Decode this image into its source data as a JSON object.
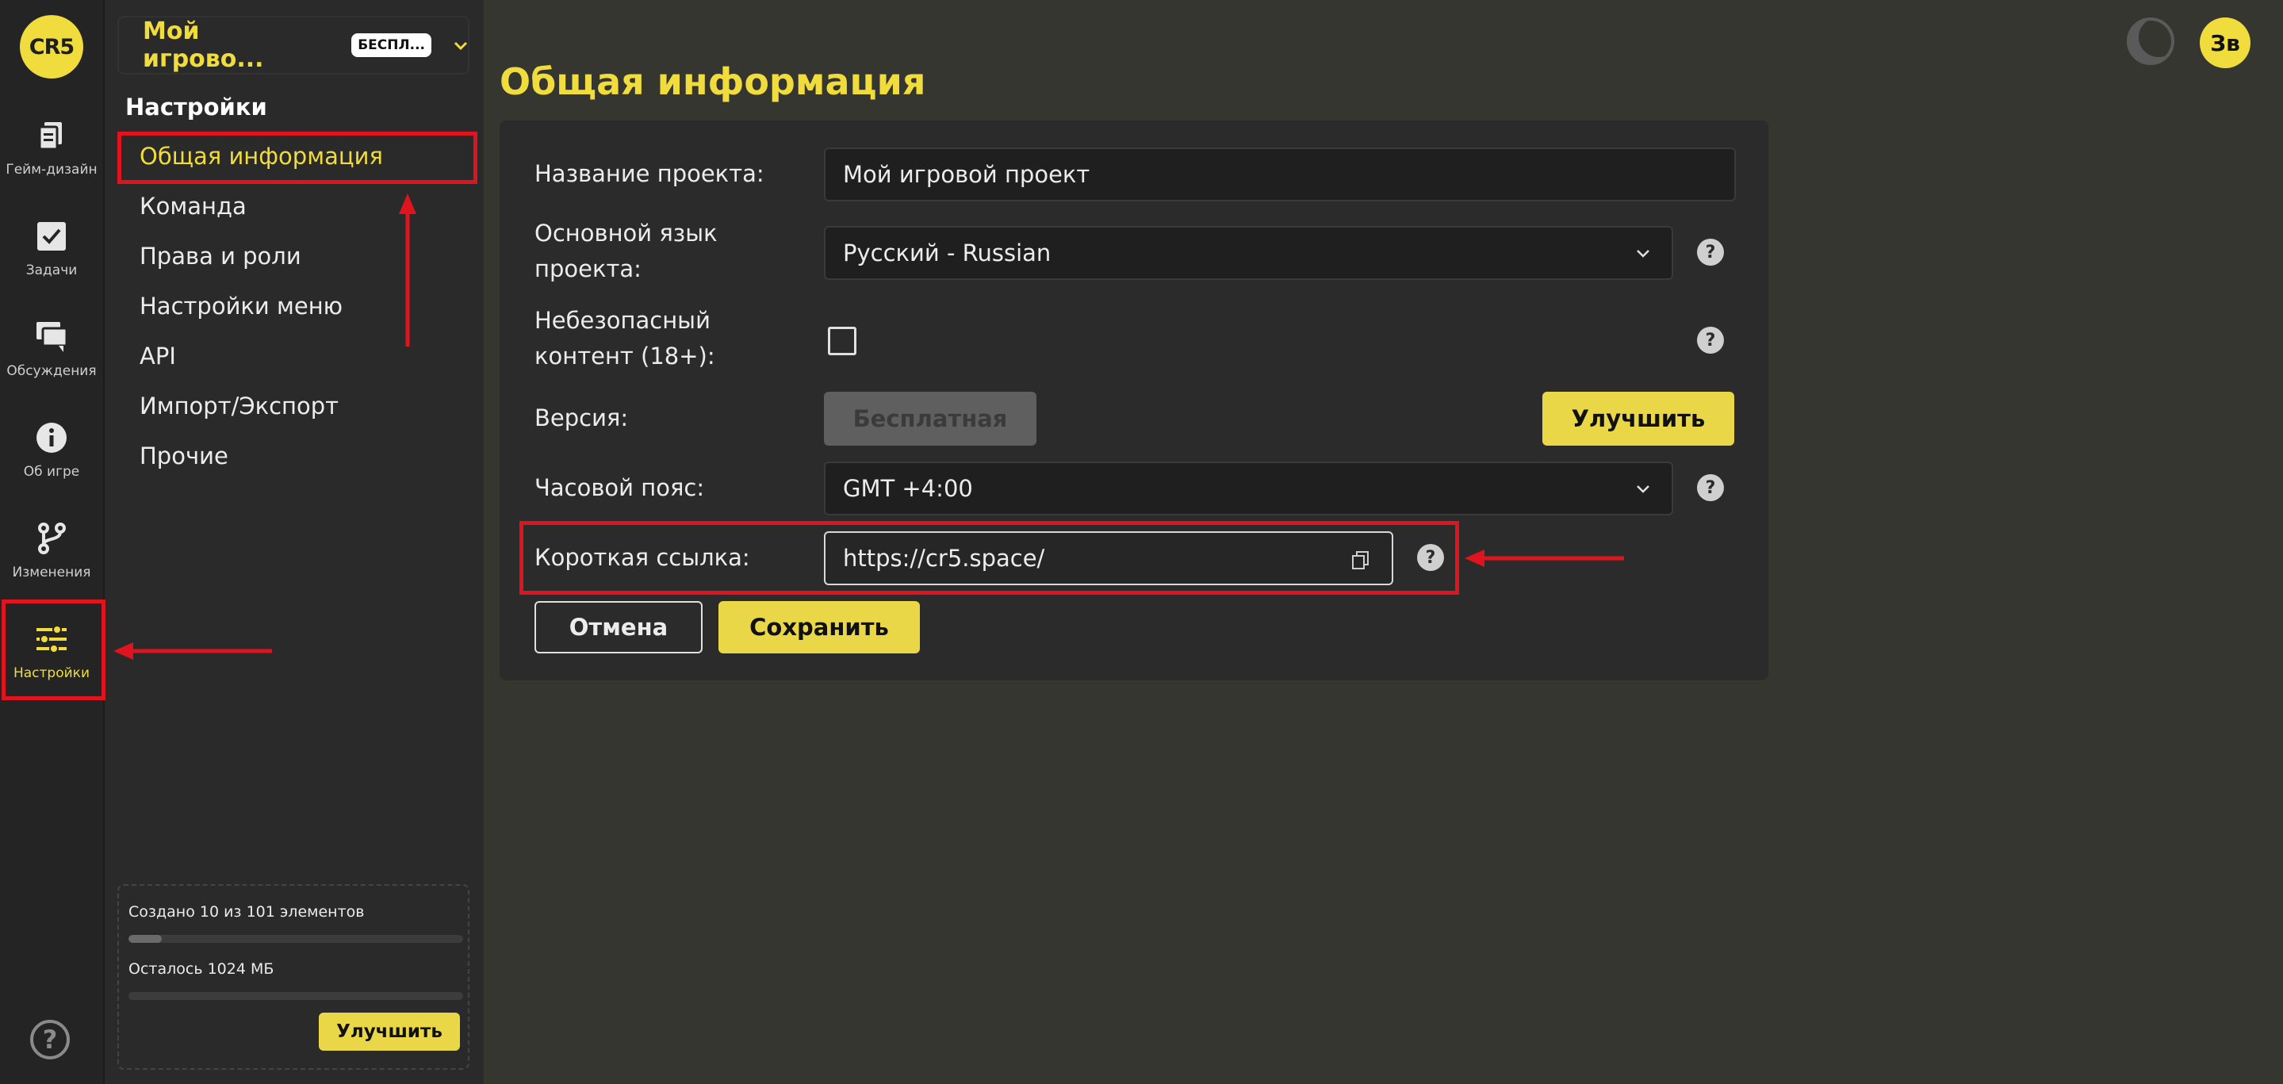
{
  "app": {
    "logo_text": "CR5",
    "accent_color": "#f0dc3c",
    "annotation_color": "#e0141e"
  },
  "rail": {
    "items": [
      {
        "label": "Гейм-дизайн",
        "icon": "documents-icon"
      },
      {
        "label": "Задачи",
        "icon": "checkbox-icon"
      },
      {
        "label": "Обсуждения",
        "icon": "chat-icon"
      },
      {
        "label": "Об игре",
        "icon": "info-icon"
      },
      {
        "label": "Изменения",
        "icon": "git-branch-icon"
      },
      {
        "label": "Настройки",
        "icon": "sliders-icon",
        "active": true
      }
    ],
    "help_icon": "?"
  },
  "panel": {
    "project_name": "Мой игрово...",
    "plan_badge": "БЕСПЛ...",
    "chevron": "⌄",
    "title": "Настройки",
    "menu": [
      {
        "label": "Общая информация",
        "active": true
      },
      {
        "label": "Команда"
      },
      {
        "label": "Права и роли"
      },
      {
        "label": "Настройки меню"
      },
      {
        "label": "API"
      },
      {
        "label": "Импорт/Экспорт"
      },
      {
        "label": "Прочие"
      }
    ],
    "usage": {
      "elements_text": "Создано 10 из 101 элементов",
      "elements_fraction": 0.099,
      "storage_text": "Осталось 1024 МБ",
      "storage_fraction": 0.0,
      "upgrade_label": "Улучшить"
    }
  },
  "header": {
    "avatar_initials": "Зв",
    "theme_icon": "moon-icon"
  },
  "main": {
    "title": "Общая информация",
    "form": {
      "project_name_label": "Название проекта:",
      "project_name_value": "Мой игровой проект",
      "language_label_line1": "Основной язык",
      "language_label_line2": "проекта:",
      "language_value": "Русский - Russian",
      "unsafe_label_line1": "Небезопасный",
      "unsafe_label_line2": "контент (18+):",
      "unsafe_checked": false,
      "version_label": "Версия:",
      "version_value": "Бесплатная",
      "upgrade_label": "Улучшить",
      "timezone_label": "Часовой пояс:",
      "timezone_value": "GMT +4:00",
      "short_link_label": "Короткая ссылка:",
      "short_link_value": "https://cr5.space/",
      "help_glyph": "?",
      "cancel_label": "Отмена",
      "save_label": "Сохранить"
    }
  }
}
